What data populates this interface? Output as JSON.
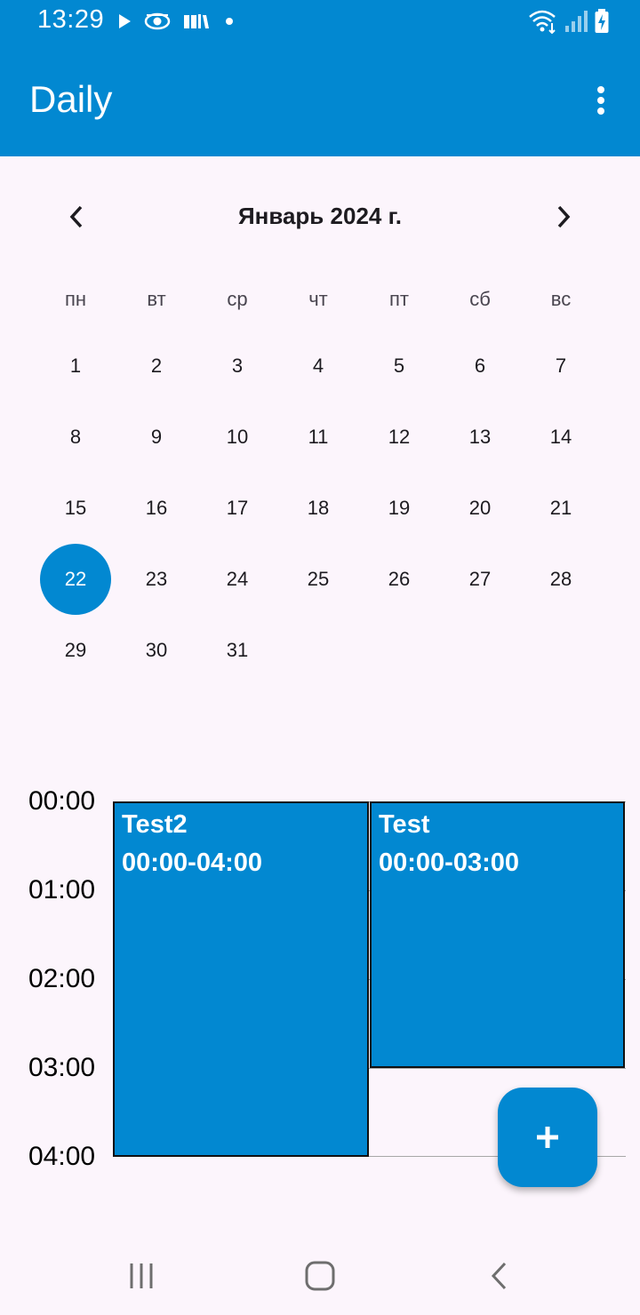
{
  "status_bar": {
    "time": "13:29",
    "icons_left": [
      "play-icon",
      "eye-icon",
      "library-icon",
      "dot-icon"
    ],
    "icons_right": [
      "wifi-icon",
      "signal-icon",
      "battery-charging-icon"
    ]
  },
  "app_bar": {
    "title": "Daily",
    "menu_icon": "more-vert-icon",
    "color": "#0288d1"
  },
  "calendar": {
    "month_title": "Январь 2024 г.",
    "prev_icon": "chevron-left-icon",
    "next_icon": "chevron-right-icon",
    "weekdays": [
      "пн",
      "вт",
      "ср",
      "чт",
      "пт",
      "сб",
      "вс"
    ],
    "weeks": [
      [
        "1",
        "2",
        "3",
        "4",
        "5",
        "6",
        "7"
      ],
      [
        "8",
        "9",
        "10",
        "11",
        "12",
        "13",
        "14"
      ],
      [
        "15",
        "16",
        "17",
        "18",
        "19",
        "20",
        "21"
      ],
      [
        "22",
        "23",
        "24",
        "25",
        "26",
        "27",
        "28"
      ],
      [
        "29",
        "30",
        "31",
        "",
        "",
        "",
        ""
      ]
    ],
    "selected_day": "22"
  },
  "schedule": {
    "hours": [
      "00:00",
      "01:00",
      "02:00",
      "03:00",
      "04:00"
    ],
    "events": [
      {
        "title": "Test2",
        "time": "00:00-04:00"
      },
      {
        "title": "Test",
        "time": "00:00-03:00"
      }
    ]
  },
  "fab": {
    "icon": "plus-icon"
  },
  "system_nav": {
    "icons": [
      "recents-icon",
      "home-icon",
      "back-icon"
    ]
  }
}
